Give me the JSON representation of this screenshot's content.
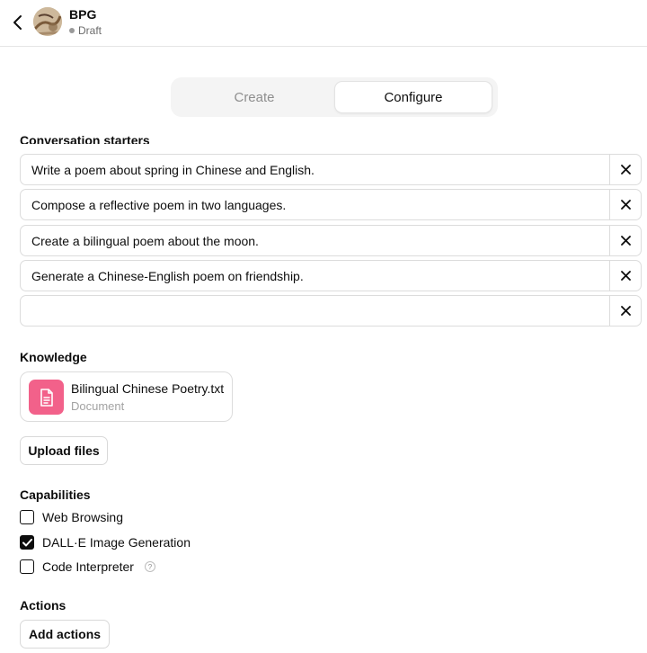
{
  "header": {
    "name": "BPG",
    "status": "Draft",
    "back_icon": "chevron-left-icon",
    "avatar": "gpt-avatar-image"
  },
  "tabs": [
    {
      "label": "Create",
      "active": false
    },
    {
      "label": "Configure",
      "active": true
    }
  ],
  "conversation_starters": {
    "title": "Conversation starters",
    "items": [
      "Write a poem about spring in Chinese and English.",
      "Compose a reflective poem in two languages.",
      "Create a bilingual poem about the moon.",
      "Generate a Chinese-English poem on friendship.",
      ""
    ],
    "remove_icon": "close-icon"
  },
  "knowledge": {
    "title": "Knowledge",
    "file": {
      "name": "Bilingual Chinese Poetry.txt",
      "type": "Document",
      "icon": "document-icon",
      "icon_color": "#f2618a"
    },
    "upload_label": "Upload files"
  },
  "capabilities": {
    "title": "Capabilities",
    "items": [
      {
        "label": "Web Browsing",
        "checked": false
      },
      {
        "label": "DALL·E Image Generation",
        "checked": true
      },
      {
        "label": "Code Interpreter",
        "checked": false,
        "help": "?"
      }
    ]
  },
  "actions": {
    "title": "Actions",
    "add_label": "Add actions"
  }
}
